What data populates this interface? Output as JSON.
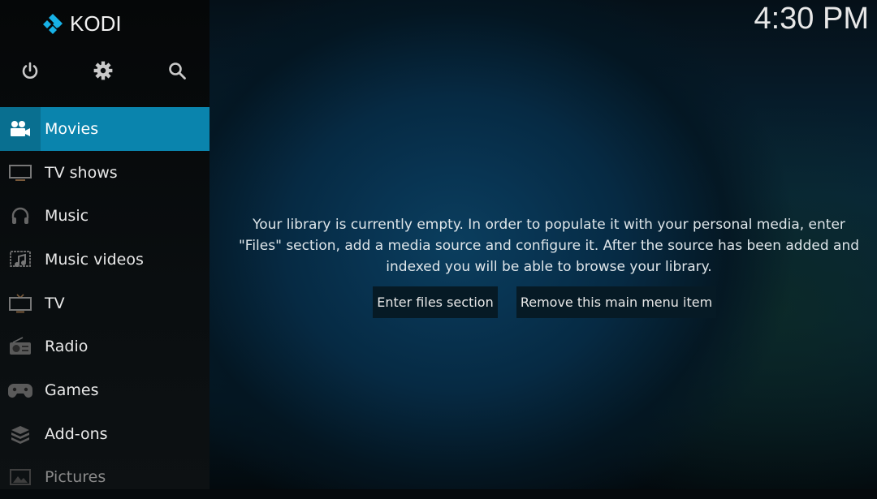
{
  "app": {
    "name": "KODI"
  },
  "clock": {
    "time": "4:30 PM"
  },
  "top_buttons": [
    {
      "name": "power",
      "icon": "power-icon"
    },
    {
      "name": "settings",
      "icon": "gear-icon"
    },
    {
      "name": "search",
      "icon": "search-icon"
    }
  ],
  "menu": {
    "items": [
      {
        "label": "Movies",
        "icon": "movie-camera-icon",
        "active": true
      },
      {
        "label": "TV shows",
        "icon": "monitor-icon"
      },
      {
        "label": "Music",
        "icon": "headphones-icon"
      },
      {
        "label": "Music videos",
        "icon": "music-video-icon"
      },
      {
        "label": "TV",
        "icon": "tv-antenna-icon"
      },
      {
        "label": "Radio",
        "icon": "radio-icon"
      },
      {
        "label": "Games",
        "icon": "gamepad-icon"
      },
      {
        "label": "Add-ons",
        "icon": "addons-box-icon"
      },
      {
        "label": "Pictures",
        "icon": "picture-icon"
      }
    ]
  },
  "main": {
    "message": "Your library is currently empty. In order to populate it with your personal media, enter \"Files\" section, add a media source and configure it. After the source has been added and indexed you will be able to browse your library.",
    "buttons": {
      "enter_files": "Enter files section",
      "remove_item": "Remove this main menu item"
    }
  },
  "colors": {
    "accent": "#0a84ad",
    "accent_dark": "#096f90",
    "logo_blue": "#17b2e7"
  }
}
